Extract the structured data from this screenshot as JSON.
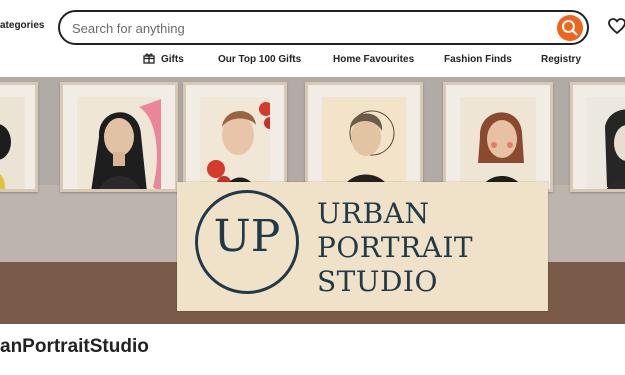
{
  "header": {
    "categories_label": "ategories",
    "search": {
      "placeholder": "Search for anything",
      "value": ""
    }
  },
  "nav": {
    "items": [
      {
        "label": "Gifts",
        "icon": "gift-icon"
      },
      {
        "label": "Our Top 100 Gifts"
      },
      {
        "label": "Home Favourites"
      },
      {
        "label": "Fashion Finds"
      },
      {
        "label": "Registry"
      }
    ]
  },
  "banner": {
    "logo_monogram": "UP",
    "logo_line1": "URBAN",
    "logo_line2": "PORTRAIT",
    "logo_line3": "STUDIO"
  },
  "shop": {
    "name": "anPortraitStudio"
  },
  "colors": {
    "accent": "#f1641e",
    "logo_ink": "#213a4a",
    "logo_card": "#efe2c8",
    "wall": "#b2aaa5",
    "floor": "#7a5a48"
  },
  "icons": [
    "search-icon",
    "heart-icon",
    "gift-icon"
  ]
}
